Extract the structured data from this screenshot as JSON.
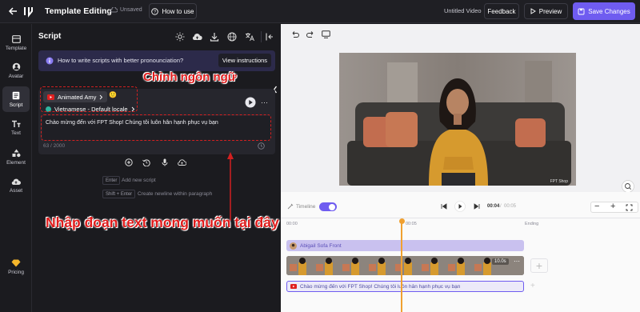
{
  "header": {
    "title": "Template Editing",
    "unsaved": "Unsaved",
    "how_to_use": "How to use",
    "doc_name": "Untitled Video",
    "feedback": "Feedback",
    "preview": "Preview",
    "save": "Save Changes"
  },
  "nav": {
    "items": [
      {
        "label": "Template",
        "icon": "template-icon"
      },
      {
        "label": "Avatar",
        "icon": "avatar-icon"
      },
      {
        "label": "Script",
        "icon": "script-icon"
      },
      {
        "label": "Text",
        "icon": "text-icon"
      },
      {
        "label": "Element",
        "icon": "element-icon"
      },
      {
        "label": "Asset",
        "icon": "asset-icon"
      }
    ],
    "pricing": "Pricing"
  },
  "script_panel": {
    "title": "Script",
    "info_text": "How to write scripts with better pronounciation?",
    "info_button": "View instructions",
    "avatar_name": "Animated Amy",
    "emoji": "🙂",
    "locale": "Vietnamese - Default locale",
    "script_text": "Chào mừng đến với FPT Shop! Chúng tôi luôn hân hạnh phục vụ bạn",
    "char_count": "63 / 2000",
    "hint_enter_key": "Enter",
    "hint_enter": "Add new script",
    "hint_shift_key": "Shift + Enter",
    "hint_shift": "Create newline within paragraph"
  },
  "annotations": {
    "language": "Chỉnh ngôn ngữ",
    "input": "Nhập đoạn text mong muốn tại đây"
  },
  "video": {
    "watermark": "FPT Shop"
  },
  "timeline": {
    "timeline_button": "Timeline",
    "current_time": "00:04",
    "total_time": "00:05",
    "ruler": [
      "00:00",
      "00:05",
      "Ending"
    ],
    "avatar_track": "Abigail Sofa Front",
    "scene_duration": "10.0s",
    "script_track": "Chào mừng đến với FPT Shop! Chúng tôi luôn hân hạnh phục vụ bạn"
  },
  "colors": {
    "accent": "#6f5cf0",
    "annotation": "#e01b1b",
    "playhead": "#f0a030"
  }
}
